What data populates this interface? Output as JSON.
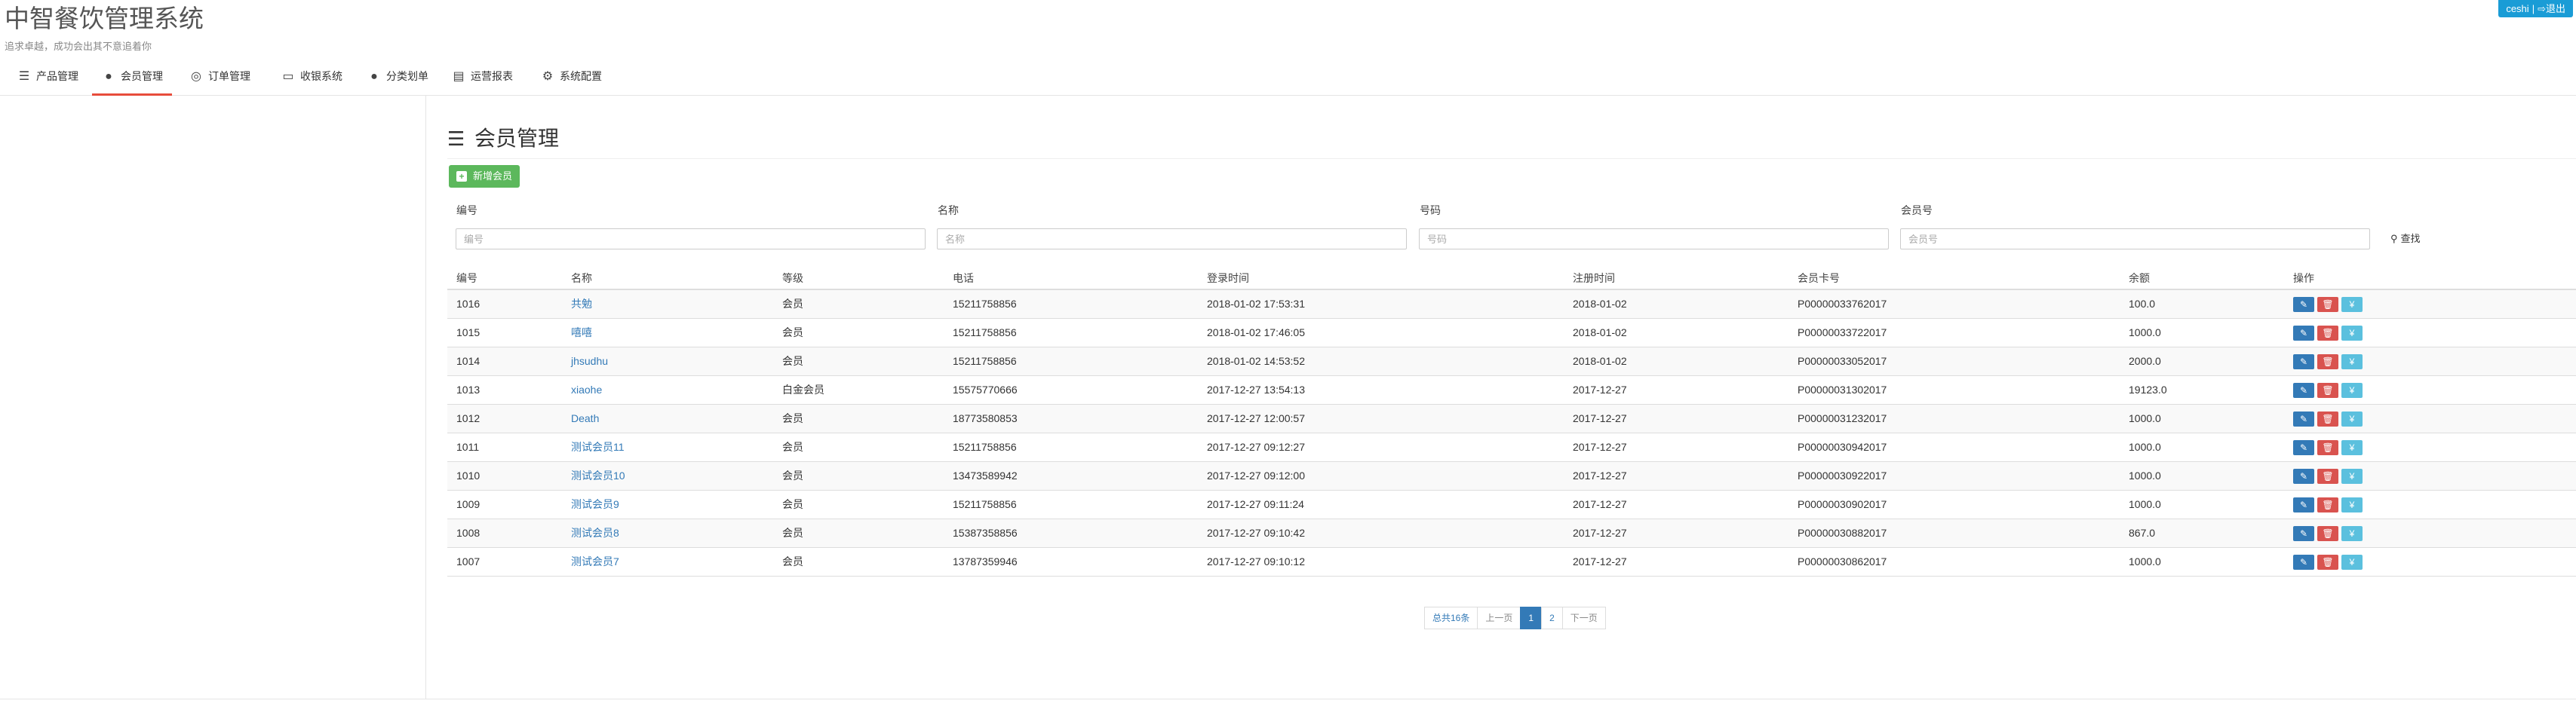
{
  "app": {
    "title": "中智餐饮管理系统",
    "subtitle": "追求卓越，成功会出其不意追着你"
  },
  "user": {
    "name": "ceshi",
    "separator": "|",
    "logout_icon": "logout-icon",
    "logout_label": "退出"
  },
  "nav": {
    "items": [
      {
        "label": "产品管理",
        "icon": "list-icon"
      },
      {
        "label": "会员管理",
        "icon": "user-icon"
      },
      {
        "label": "订单管理",
        "icon": "coins-icon"
      },
      {
        "label": "收银系统",
        "icon": "laptop-icon"
      },
      {
        "label": "分类划单",
        "icon": "user-icon"
      },
      {
        "label": "运营报表",
        "icon": "chart-icon"
      },
      {
        "label": "系统配置",
        "icon": "gear-icon"
      }
    ],
    "active_index": 1
  },
  "page": {
    "title": "会员管理",
    "add_button_label": "新增会员"
  },
  "search": {
    "fields": [
      {
        "label": "编号",
        "placeholder": "编号",
        "value": ""
      },
      {
        "label": "名称",
        "placeholder": "名称",
        "value": ""
      },
      {
        "label": "号码",
        "placeholder": "号码",
        "value": ""
      },
      {
        "label": "会员号",
        "placeholder": "会员号",
        "value": ""
      }
    ],
    "button_label": "查找"
  },
  "table": {
    "headers": [
      "编号",
      "名称",
      "等级",
      "电话",
      "登录时间",
      "注册时间",
      "会员卡号",
      "余额",
      "操作"
    ],
    "rows": [
      {
        "id": "1016",
        "name": "共勉",
        "level": "会员",
        "phone": "15211758856",
        "login": "2018-01-02 17:53:31",
        "registered": "2018-01-02",
        "card": "P00000033762017",
        "balance": "100.0"
      },
      {
        "id": "1015",
        "name": "嘻嘻",
        "level": "会员",
        "phone": "15211758856",
        "login": "2018-01-02 17:46:05",
        "registered": "2018-01-02",
        "card": "P00000033722017",
        "balance": "1000.0"
      },
      {
        "id": "1014",
        "name": "jhsudhu",
        "level": "会员",
        "phone": "15211758856",
        "login": "2018-01-02 14:53:52",
        "registered": "2018-01-02",
        "card": "P00000033052017",
        "balance": "2000.0"
      },
      {
        "id": "1013",
        "name": "xiaohe",
        "level": "白金会员",
        "phone": "15575770666",
        "login": "2017-12-27 13:54:13",
        "registered": "2017-12-27",
        "card": "P00000031302017",
        "balance": "19123.0"
      },
      {
        "id": "1012",
        "name": "Death",
        "level": "会员",
        "phone": "18773580853",
        "login": "2017-12-27 12:00:57",
        "registered": "2017-12-27",
        "card": "P00000031232017",
        "balance": "1000.0"
      },
      {
        "id": "1011",
        "name": "测试会员11",
        "level": "会员",
        "phone": "15211758856",
        "login": "2017-12-27 09:12:27",
        "registered": "2017-12-27",
        "card": "P00000030942017",
        "balance": "1000.0"
      },
      {
        "id": "1010",
        "name": "测试会员10",
        "level": "会员",
        "phone": "13473589942",
        "login": "2017-12-27 09:12:00",
        "registered": "2017-12-27",
        "card": "P00000030922017",
        "balance": "1000.0"
      },
      {
        "id": "1009",
        "name": "测试会员9",
        "level": "会员",
        "phone": "15211758856",
        "login": "2017-12-27 09:11:24",
        "registered": "2017-12-27",
        "card": "P00000030902017",
        "balance": "1000.0"
      },
      {
        "id": "1008",
        "name": "测试会员8",
        "level": "会员",
        "phone": "15387358856",
        "login": "2017-12-27 09:10:42",
        "registered": "2017-12-27",
        "card": "P00000030882017",
        "balance": "867.0"
      },
      {
        "id": "1007",
        "name": "测试会员7",
        "level": "会员",
        "phone": "13787359946",
        "login": "2017-12-27 09:10:12",
        "registered": "2017-12-27",
        "card": "P00000030862017",
        "balance": "1000.0"
      }
    ],
    "actions": [
      {
        "name": "edit",
        "icon": "pencil-icon",
        "color": "#337ab7"
      },
      {
        "name": "delete",
        "icon": "trash-icon",
        "color": "#d9534f"
      },
      {
        "name": "recharge",
        "icon": "yen-icon",
        "color": "#5bc0de"
      }
    ]
  },
  "pagination": {
    "total_label": "总共16条",
    "prev_label": "上一页",
    "pages": [
      "1",
      "2"
    ],
    "current": "1",
    "next_label": "下一页"
  },
  "colors": {
    "brand": "#1a9cd6",
    "nav_active_underline": "#e74c3c",
    "add_button": "#5cb85c",
    "link": "#337ab7"
  }
}
